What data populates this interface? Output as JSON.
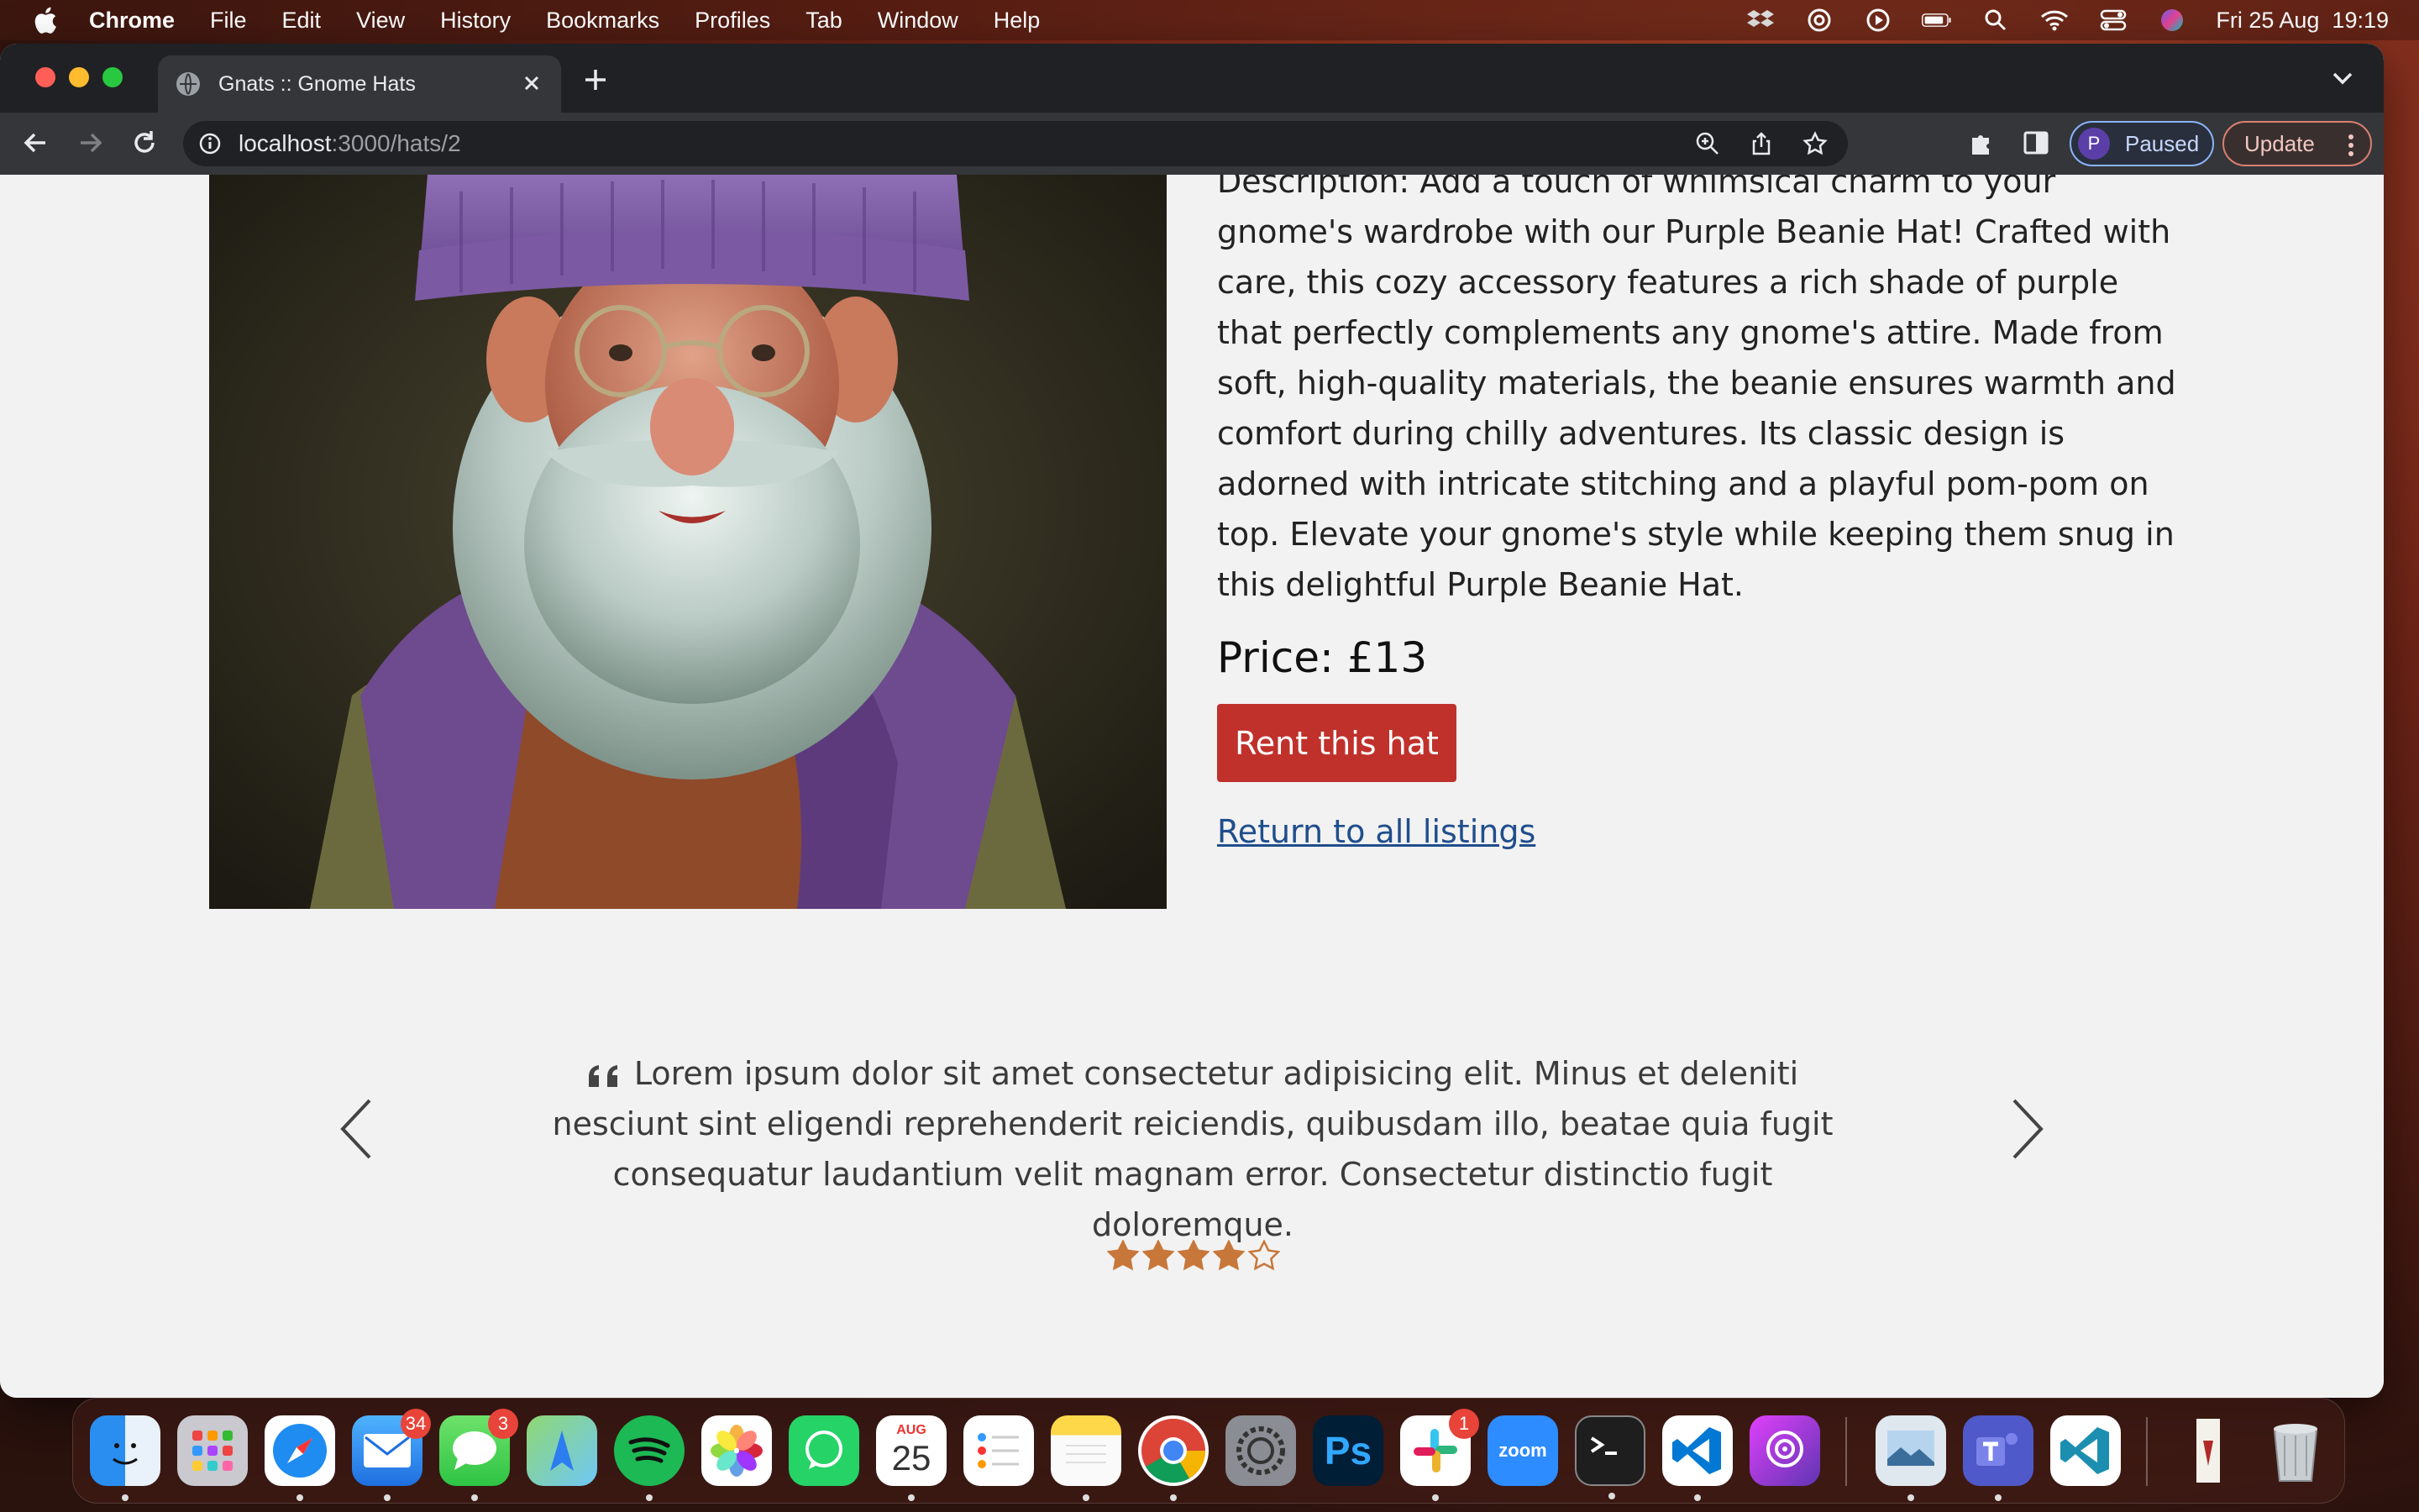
{
  "menubar": {
    "app_name": "Chrome",
    "items": [
      "File",
      "Edit",
      "View",
      "History",
      "Bookmarks",
      "Profiles",
      "Tab",
      "Window",
      "Help"
    ],
    "datetime": "Fri 25 Aug  19:19"
  },
  "browser": {
    "tab_title": "Gnats :: Gnome Hats",
    "url_host": "localhost",
    "url_path": ":3000/hats/2",
    "profile_initial": "P",
    "profile_status": "Paused",
    "update_label": "Update"
  },
  "product": {
    "image_alt": "Gnome wearing purple beanie and scarf",
    "description": "Description: Add a touch of whimsical charm to your gnome's wardrobe with our Purple Beanie Hat! Crafted with care, this cozy accessory features a rich shade of purple that perfectly complements any gnome's attire. Made from soft, high-quality materials, the beanie ensures warmth and comfort during chilly adventures. Its classic design is adorned with intricate stitching and a playful pom-pom on top. Elevate your gnome's style while keeping them snug in this delightful Purple Beanie Hat.",
    "price": "Price: £13",
    "rent_label": "Rent this hat",
    "return_label": "Return to all listings"
  },
  "testimonial": {
    "quote": "Lorem ipsum dolor sit amet consectetur adipisicing elit. Minus et deleniti nesciunt sint eligendi reprehenderit reiciendis, quibusdam illo, beatae quia fugit consequatur laudantium velit magnam error. Consectetur distinctio fugit doloremque.",
    "rating": 4,
    "rating_max": 5,
    "star_color": "#c8773a"
  },
  "dock": {
    "mail_badge": "34",
    "messages_badge": "3",
    "slack_badge": "1",
    "calendar_month": "AUG",
    "calendar_day": "25",
    "zoom_label": "zoom",
    "ps_label": "Ps"
  },
  "colors": {
    "rent_button": "#c0312b",
    "link": "#1f4e8c"
  }
}
